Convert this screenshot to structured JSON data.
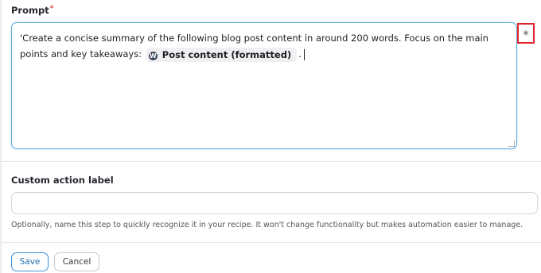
{
  "prompt_field": {
    "label": "Prompt",
    "required_marker": "*",
    "text_before_token": "'Create a concise summary of the following blog post content in around 200 words. Focus on the main points and key takeaways:",
    "token": {
      "icon": "wordpress-icon",
      "icon_glyph": "W",
      "label": "Post content (formatted)"
    },
    "text_after_token": "."
  },
  "insert_variable_button": {
    "glyph": "*"
  },
  "custom_label_field": {
    "label": "Custom action label",
    "value": "",
    "help_text": "Optionally, name this step to quickly recognize it in your recipe. It won't change functionality but makes automation easier to manage."
  },
  "actions": {
    "save_label": "Save",
    "cancel_label": "Cancel"
  },
  "colors": {
    "focus_border": "#5ea9dd",
    "highlight_border": "#e0262d",
    "save_accent": "#2271b1",
    "required_red": "#d63638"
  }
}
